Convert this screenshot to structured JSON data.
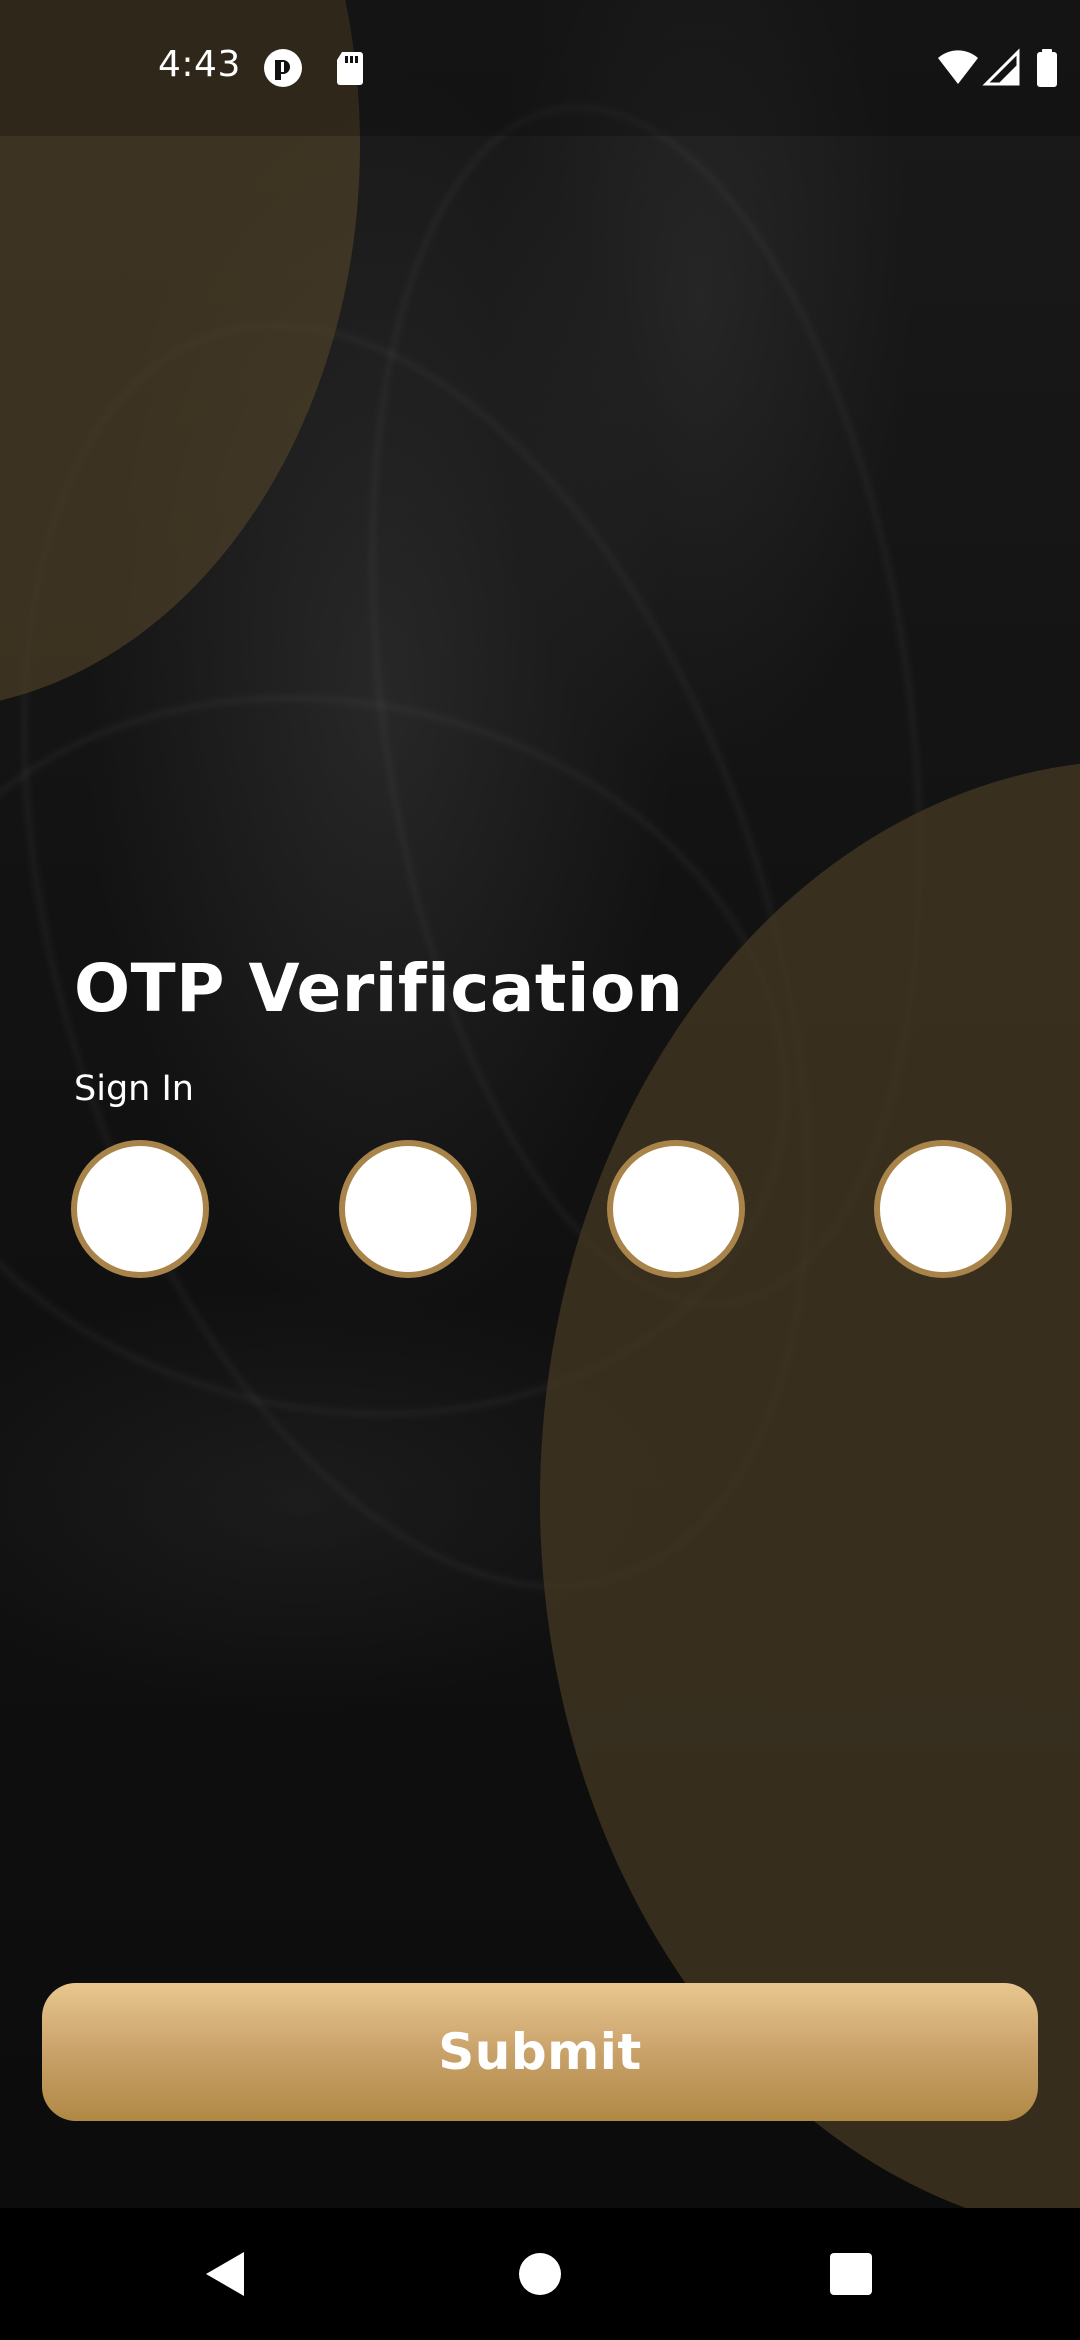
{
  "status_bar": {
    "time": "4:43",
    "left_icons": [
      "ring-icon",
      "sd-card-icon"
    ],
    "right_icons": [
      "wifi-icon",
      "signal-icon",
      "battery-icon"
    ]
  },
  "screen": {
    "title": "OTP Verification",
    "subtitle": "Sign In",
    "otp_digits": [
      "",
      "",
      "",
      ""
    ],
    "submit_label": "Submit"
  },
  "nav_bar": {
    "buttons": [
      "back-icon",
      "home-icon",
      "recents-icon"
    ]
  },
  "colors": {
    "accent_gold": "#c9a26a",
    "otp_border": "#a8844a",
    "background": "#121212",
    "overlay_gold": "#544428"
  }
}
